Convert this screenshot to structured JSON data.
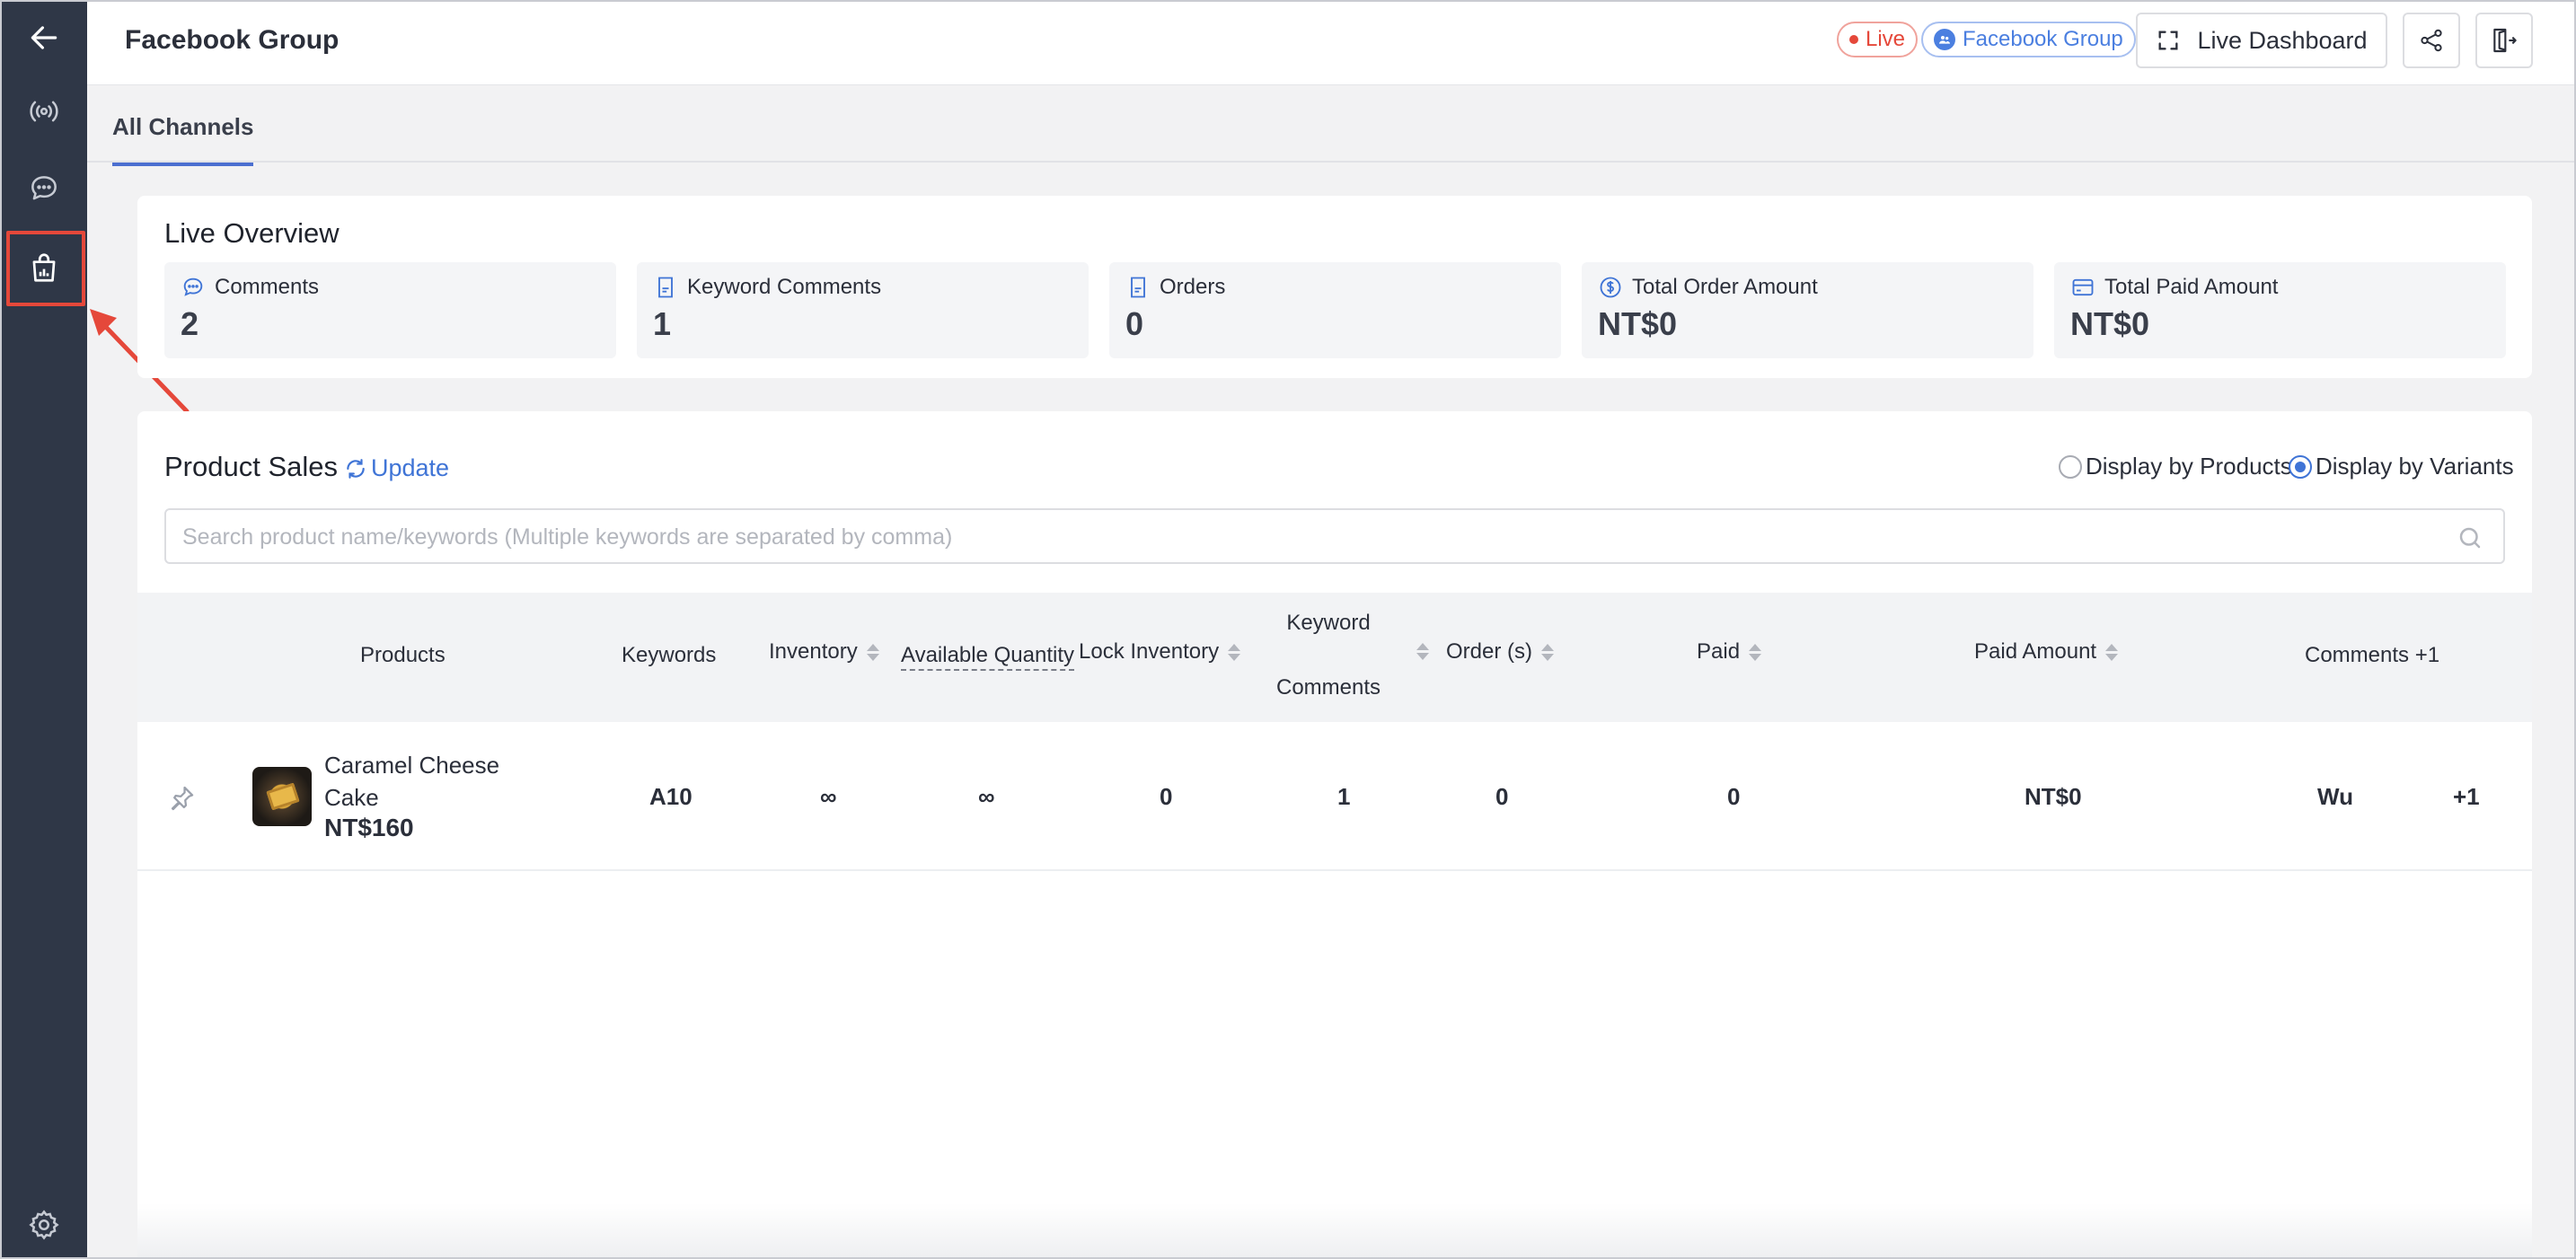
{
  "header": {
    "title": "Facebook Group",
    "live_badge": "Live",
    "group_badge": "Facebook Group",
    "live_dashboard_label": "Live Dashboard"
  },
  "tabs": [
    {
      "label": "All Channels"
    }
  ],
  "overview": {
    "title": "Live Overview",
    "stats": [
      {
        "label": "Comments",
        "value": "2",
        "icon": "comment-icon"
      },
      {
        "label": "Keyword Comments",
        "value": "1",
        "icon": "document-icon"
      },
      {
        "label": "Orders",
        "value": "0",
        "icon": "document-icon"
      },
      {
        "label": "Total Order Amount",
        "value": "NT$0",
        "icon": "dollar-icon"
      },
      {
        "label": "Total Paid Amount",
        "value": "NT$0",
        "icon": "card-icon"
      }
    ]
  },
  "product_sales": {
    "title": "Product Sales",
    "update_label": "Update",
    "display_options": [
      {
        "label": "Display by Products",
        "selected": false
      },
      {
        "label": "Display by Variants",
        "selected": true
      }
    ],
    "search_placeholder": "Search product name/keywords (Multiple keywords are separated by comma)",
    "columns": {
      "products": "Products",
      "keywords": "Keywords",
      "inventory": "Inventory",
      "available_quantity": "Available Quantity",
      "lock_inventory": "Lock Inventory",
      "keyword_comments_1": "Keyword",
      "keyword_comments_2": "Comments",
      "orders": "Order (s)",
      "paid": "Paid",
      "paid_amount": "Paid Amount",
      "comments": "Comments +1"
    },
    "rows": [
      {
        "name_line1": "Caramel Cheese",
        "name_line2": "Cake",
        "price": "NT$160",
        "keyword": "A10",
        "inventory": "∞",
        "available_quantity": "∞",
        "lock_inventory": "0",
        "keyword_comments": "1",
        "orders": "0",
        "paid": "0",
        "paid_amount": "NT$0",
        "commenter": "Wu",
        "comment_text": "+1"
      }
    ]
  },
  "colors": {
    "sidebar": "#2f3747",
    "accent": "#3f74d6",
    "live": "#e5483a",
    "highlight": "#e5483a"
  }
}
